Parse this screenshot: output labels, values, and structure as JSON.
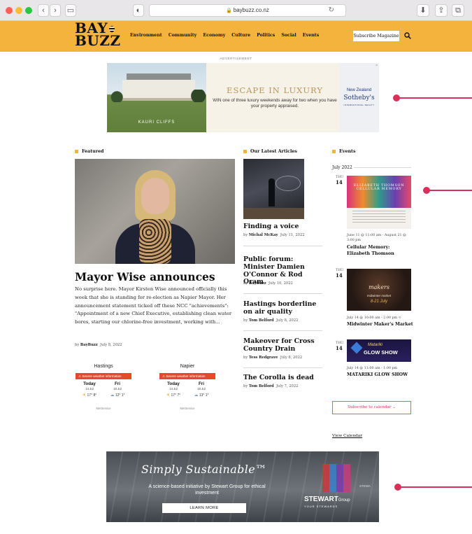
{
  "browser": {
    "url": "baybuzz.co.nz"
  },
  "header": {
    "logo_line1": "BAY",
    "logo_line2": "BUZZ",
    "nav": [
      "Environment",
      "Community",
      "Economy",
      "Culture",
      "Politics",
      "Social",
      "Events"
    ],
    "subscribe_label": "Subscribe Magazine",
    "accent_color": "#f3b33d"
  },
  "ad_top": {
    "label": "ADVERTISEMENT",
    "photo_caption": "KAURI CLIFFS",
    "headline": "ESCAPE IN LUXURY",
    "subtext": "WIN one of three luxury weekends away for two when you have your property appraised.",
    "brand_line1": "New Zealand",
    "brand_line2": "Sotheby's",
    "brand_line3": "INTERNATIONAL REALTY"
  },
  "featured": {
    "heading": "Featured",
    "title": "Mayor Wise announces",
    "excerpt": "No surprise here. Mayor Kirsten Wise announced officially this week that she is standing for re-election as Napier Mayor. Her announcement statement ticked off these NCC \"achievements\": \"Appointment of a new Chief Executive, establishing clean water bores, starting our chlorine-free investment, working with...",
    "by_prefix": "by",
    "author": "BayBuzz",
    "date": "July 8, 2022"
  },
  "weather": [
    {
      "city": "Hastings",
      "warning": "Severe weather information",
      "today_label": "Today",
      "today_date": "14 Jul",
      "today_temps": "17° 8°",
      "next_label": "Fri",
      "next_date": "15 Jul",
      "next_temps": "12° 1°",
      "provider": "MetService"
    },
    {
      "city": "Napier",
      "warning": "Severe weather information",
      "today_label": "Today",
      "today_date": "14 Jul",
      "today_temps": "17° 7°",
      "next_label": "Fri",
      "next_date": "15 Jul",
      "next_temps": "13° 1°",
      "provider": "MetService"
    }
  ],
  "articles": {
    "heading": "Our Latest Articles",
    "items": [
      {
        "title": "Finding a voice",
        "author": "Michal McKay",
        "date": "July 11, 2022"
      },
      {
        "title": "Public forum: Minister Damien O'Connor & Rod Oram",
        "author": "BayBuzz",
        "date": "July 10, 2022"
      },
      {
        "title": "Hastings borderline on air quality",
        "author": "Tom Belford",
        "date": "July 8, 2022"
      },
      {
        "title": "Makeover for Cross Country Drain",
        "author": "Tess Redgrave",
        "date": "July 8, 2022"
      },
      {
        "title": "The Corolla is dead",
        "author": "Tom Belford",
        "date": "July 7, 2022"
      }
    ]
  },
  "events": {
    "heading": "Events",
    "month": "July 2022",
    "items": [
      {
        "dow": "THU",
        "day": "14",
        "image_caption": "ELIZABETH THOMSON CELLULAR MEMORY",
        "time": "June 11 @ 11:00 am - August 21 @ 3:00 pm",
        "title": "Cellular Memory: Elizabeth Thomson"
      },
      {
        "dow": "THU",
        "day": "14",
        "image_caption": "makers",
        "image_caption2": "midwinter market",
        "image_caption3": "8-21 July",
        "time": "July 14 @ 10:00 am - 2:00 pm",
        "title": "Midwinter Maker's Market"
      },
      {
        "dow": "THU",
        "day": "14",
        "image_caption": "Matariki",
        "image_caption2": "GLOW SHOW",
        "time": "July 14 @ 11:00 am - 1:00 pm",
        "title": "MATARIKI GLOW SHOW"
      }
    ],
    "subscribe_label": "Subscribe to calendar",
    "view_label": "View Calendar"
  },
  "ad_bottom": {
    "headline": "Simply Sustainable™",
    "tagline": "A science-based initiative by Stewart Group for ethical investment",
    "button": "LEARN MORE",
    "brand": "STEWART",
    "brand_suffix": "Group",
    "brand_sub": "YOUR STEWARDS",
    "sign_text": "STEWA"
  }
}
